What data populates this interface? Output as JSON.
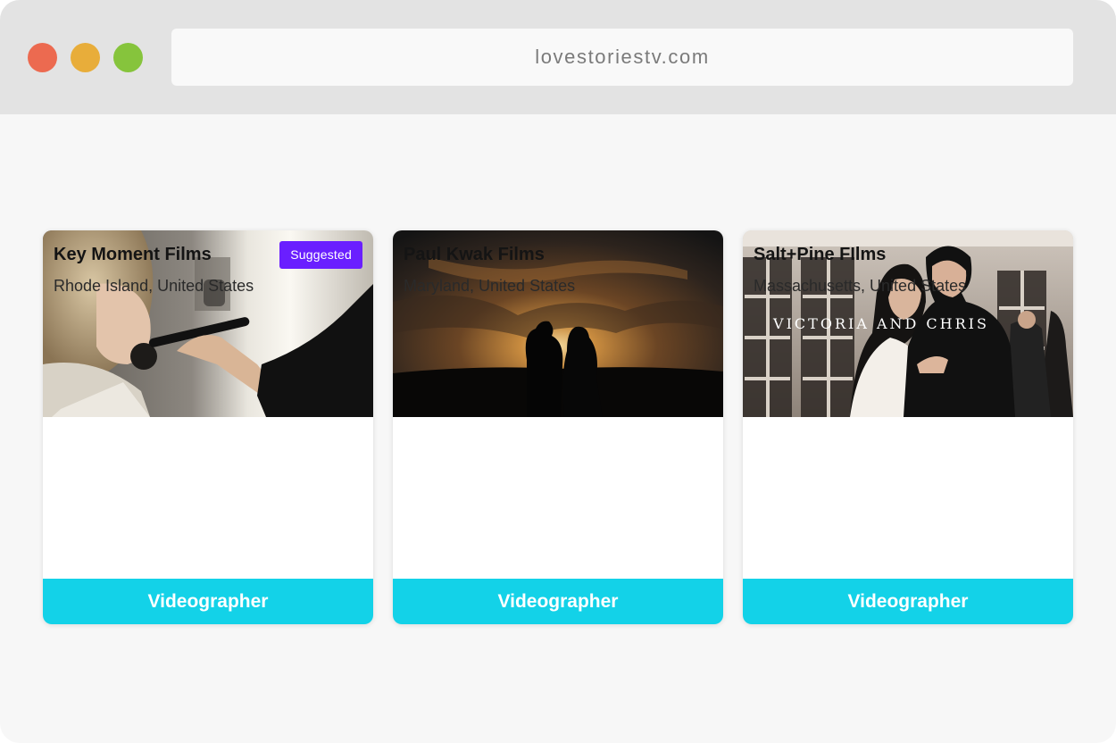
{
  "browser": {
    "url": "lovestoriestv.com"
  },
  "cards": [
    {
      "badge": "Suggested",
      "name": "Key Moment Films",
      "location": "Rhode Island, United States",
      "role": "Videographer"
    },
    {
      "name": "Paul Kwak Films",
      "location": "Maryland, United States",
      "role": "Videographer"
    },
    {
      "image_text": "VICTORIA AND CHRIS",
      "name": "Salt+Pine FIlms",
      "location": "Massachusetts, United States",
      "role": "Videographer"
    }
  ],
  "colors": {
    "badge": "#6a1fff",
    "role_bar": "#13d2e8",
    "dot_red": "#ec6a50",
    "dot_yellow": "#e8ad3a",
    "dot_green": "#86c43c"
  }
}
